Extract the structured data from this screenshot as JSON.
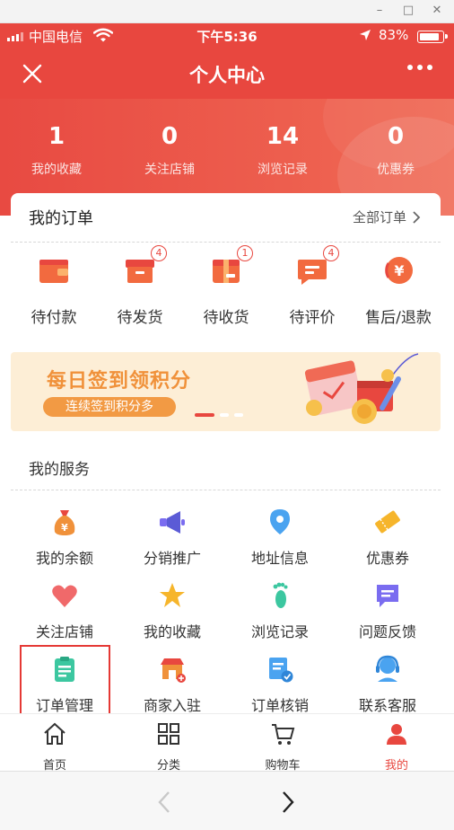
{
  "window": {
    "minimize": "–",
    "maximize": "□",
    "close": "✕"
  },
  "status_bar": {
    "carrier": "中国电信",
    "time": "下午5:36",
    "battery_pct": "83%"
  },
  "nav": {
    "title": "个人中心"
  },
  "stats": [
    {
      "value": "1",
      "label": "我的收藏"
    },
    {
      "value": "0",
      "label": "关注店铺"
    },
    {
      "value": "14",
      "label": "浏览记录"
    },
    {
      "value": "0",
      "label": "优惠券"
    }
  ],
  "orders": {
    "title": "我的订单",
    "all_label": "全部订单",
    "items": [
      {
        "label": "待付款",
        "badge": null,
        "icon": "wallet-icon"
      },
      {
        "label": "待发货",
        "badge": "4",
        "icon": "box-icon"
      },
      {
        "label": "待收货",
        "badge": "1",
        "icon": "package-icon"
      },
      {
        "label": "待评价",
        "badge": "4",
        "icon": "comment-icon"
      },
      {
        "label": "售后/退款",
        "badge": null,
        "icon": "refund-icon"
      }
    ]
  },
  "banner": {
    "title": "每日签到领积分",
    "subtitle": "连续签到积分多"
  },
  "services": {
    "title": "我的服务",
    "items": [
      {
        "label": "我的余额",
        "icon": "money-bag-icon"
      },
      {
        "label": "分销推广",
        "icon": "megaphone-icon"
      },
      {
        "label": "地址信息",
        "icon": "location-icon"
      },
      {
        "label": "优惠券",
        "icon": "ticket-icon"
      },
      {
        "label": "关注店铺",
        "icon": "heart-icon"
      },
      {
        "label": "我的收藏",
        "icon": "star-icon"
      },
      {
        "label": "浏览记录",
        "icon": "footprint-icon"
      },
      {
        "label": "问题反馈",
        "icon": "feedback-icon"
      },
      {
        "label": "订单管理",
        "icon": "clipboard-icon"
      },
      {
        "label": "商家入驻",
        "icon": "shop-icon"
      },
      {
        "label": "订单核销",
        "icon": "verify-icon"
      },
      {
        "label": "联系客服",
        "icon": "headset-icon"
      }
    ]
  },
  "tabbar": [
    {
      "label": "首页",
      "icon": "home-icon",
      "active": false
    },
    {
      "label": "分类",
      "icon": "grid-icon",
      "active": false
    },
    {
      "label": "购物车",
      "icon": "cart-icon",
      "active": false
    },
    {
      "label": "我的",
      "icon": "user-icon",
      "active": true
    }
  ],
  "colors": {
    "brand": "#e8473f",
    "orange": "#f0913a",
    "banner_bg": "#fdeed6"
  }
}
